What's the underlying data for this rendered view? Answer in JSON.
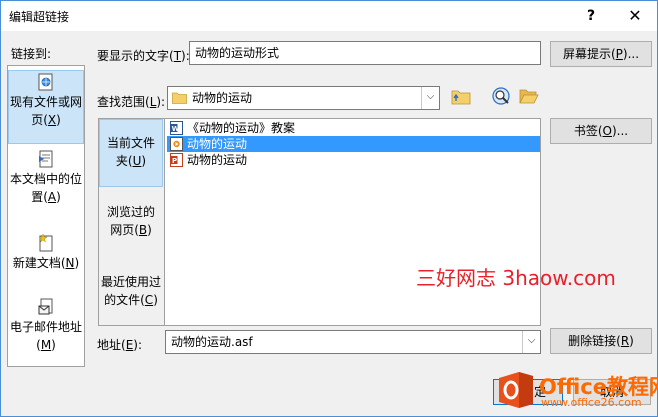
{
  "window": {
    "title": "编辑超链接",
    "help_label": "?",
    "close_label": "✕"
  },
  "link_to": {
    "label": "链接到:",
    "items": [
      {
        "label": "现有文件或网页(X)",
        "line1": "现有文件或网",
        "line2": "页(",
        "key": "X",
        "tail": ")",
        "icon": "web-page-icon",
        "selected": true
      },
      {
        "label": "本文档中的位置(A)",
        "line1": "本文档中的位",
        "line2": "置(",
        "key": "A",
        "tail": ")",
        "icon": "document-place-icon",
        "selected": false
      },
      {
        "label": "新建文档(N)",
        "line1": "新建文档(",
        "line2": "",
        "key": "N",
        "tail": ")",
        "icon": "new-document-icon",
        "selected": false
      },
      {
        "label": "电子邮件地址(M)",
        "line1": "电子邮件地址",
        "line2": "(",
        "key": "M",
        "tail": ")",
        "icon": "email-icon",
        "selected": false
      }
    ]
  },
  "display_text": {
    "label_pre": "要显示的文字(",
    "label_key": "T",
    "label_post": "):",
    "value": "动物的运动形式"
  },
  "screen_tip_button": {
    "pre": "屏幕提示(",
    "key": "P",
    "post": ")..."
  },
  "look_in": {
    "label_pre": "查找范围(",
    "label_key": "L",
    "label_post": "):",
    "value": "动物的运动",
    "arrow": "⌵"
  },
  "browse_tabs": [
    {
      "line1": "当前文件",
      "line2": "夹(",
      "key": "U",
      "tail": ")",
      "selected": true
    },
    {
      "line1": "浏览过的",
      "line2": "网页(",
      "key": "B",
      "tail": ")",
      "selected": false
    },
    {
      "line1": "最近使用过",
      "line2": "的文件(",
      "key": "C",
      "tail": ")",
      "selected": false
    }
  ],
  "files": [
    {
      "name": "《动物的运动》教案",
      "icon": "word-doc-icon",
      "selected": false
    },
    {
      "name": "动物的运动",
      "icon": "media-file-icon",
      "selected": true
    },
    {
      "name": "动物的运动",
      "icon": "powerpoint-file-icon",
      "selected": false
    }
  ],
  "bookmark_button": {
    "pre": "书签(",
    "key": "O",
    "post": ")..."
  },
  "address": {
    "label_pre": "地址(",
    "label_key": "E",
    "label_post": "):",
    "value": "动物的运动.asf",
    "arrow": "⌵"
  },
  "remove_link_button": {
    "pre": "删除链接(",
    "key": "R",
    "post": ")"
  },
  "ok_button": {
    "label": "定"
  },
  "cancel_button": {
    "label": "取消"
  },
  "watermarks": {
    "site_cn": "三好网志 3haow.com",
    "office_brand": "Office教程网",
    "office_url": "www.office26.com"
  },
  "colors": {
    "selection": "#3399ff",
    "tab_selected": "#cce4f7",
    "watermark_red": "#e8202a",
    "watermark_orange": "#ff6a00"
  }
}
